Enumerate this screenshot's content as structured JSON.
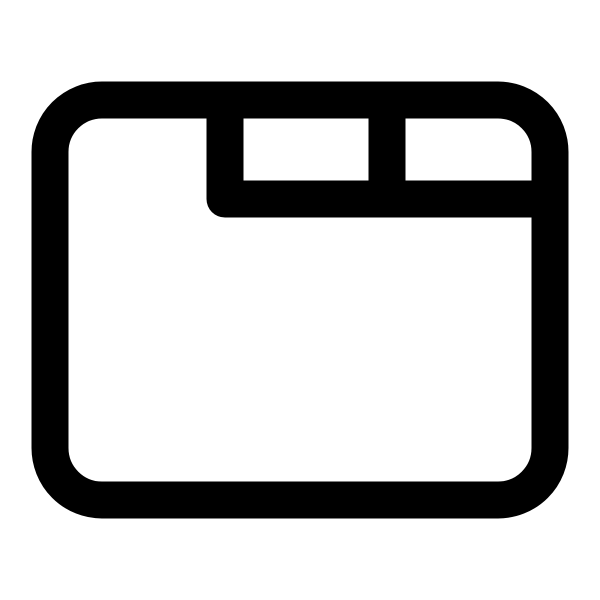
{
  "icon": {
    "name": "browser-tabs-icon",
    "stroke_color": "#000000",
    "background_color": "#ffffff"
  }
}
